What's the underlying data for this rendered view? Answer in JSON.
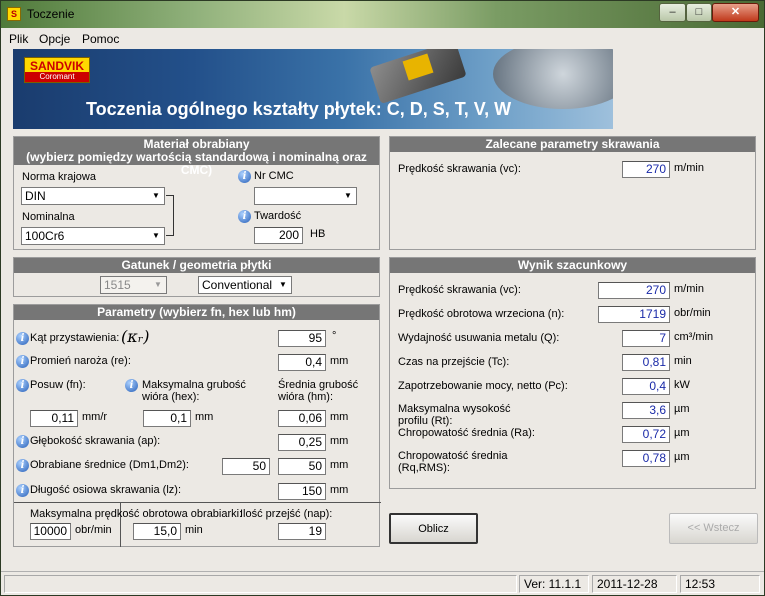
{
  "window": {
    "title": "Toczenie",
    "app_icon": "S",
    "controls": {
      "minimize": "–",
      "maximize": "□",
      "close": "✕"
    }
  },
  "menu": [
    "Plik",
    "Opcje",
    "Pomoc"
  ],
  "banner": {
    "logo_name": "SANDVIK",
    "logo_sub": "Coromant",
    "title": "Toczenia ogólnego  kształty płytek:  C, D, S, T, V, W"
  },
  "material": {
    "header_line1": "Materiał obrabiany",
    "header_line2": "(wybierz pomiędzy wartością standardową i nominalną oraz CMC)",
    "norma_label": "Norma krajowa",
    "norma_value": "DIN",
    "nominalna_label": "Nominalna",
    "nominalna_value": "100Cr6",
    "cmc_label": "Nr CMC",
    "cmc_value": "",
    "twardosc_label": "Twardość",
    "twardosc_value": "200",
    "twardosc_unit": "HB"
  },
  "gatunek": {
    "header": "Gatunek / geometria płytki",
    "grade_value": "1515",
    "geometry_value": "Conventional"
  },
  "params": {
    "header": "Parametry (wybierz fn, hex lub hm)",
    "kat_label": "Kąt przystawienia:",
    "kappa_symbol": "(κᵣ)",
    "kat_value": "95",
    "kat_unit": "°",
    "promien_label": "Promień naroża (re):",
    "promien_value": "0,4",
    "promien_unit": "mm",
    "posuw_label": "Posuw (fn):",
    "posuw_value": "0,11",
    "posuw_unit": "mm/r",
    "hex_label1": "Maksymalna grubość",
    "hex_label2": "wióra (hex):",
    "hex_value": "0,1",
    "hex_unit": "mm",
    "hm_label1": "Średnia grubość",
    "hm_label2": "wióra (hm):",
    "hm_value": "0,06",
    "hm_unit": "mm",
    "ap_label": "Głębokość skrawania (ap):",
    "ap_value": "0,25",
    "ap_unit": "mm",
    "dm_label": "Obrabiane średnice (Dm1,Dm2):",
    "dm1_value": "50",
    "dm2_value": "50",
    "dm_unit": "mm",
    "lz_label": "Długość osiowa skrawania (lz):",
    "lz_value": "150",
    "lz_unit": "mm",
    "maxrpm_label": "Maksymalna prędkość obrotowa obrabiarki:",
    "maxrpm_value": "10000",
    "maxrpm_unit": "obr/min",
    "nap_label": "Ilość przejść (nap):",
    "time_value": "15,0",
    "time_unit": "min",
    "nap_value": "19"
  },
  "zalecane": {
    "header": "Zalecane parametry skrawania",
    "vc_label": "Prędkość skrawania (vc):",
    "vc_value": "270",
    "vc_unit": "m/min"
  },
  "wynik": {
    "header": "Wynik szacunkowy",
    "vc_label": "Prędkość skrawania (vc):",
    "vc_value": "270",
    "vc_unit": "m/min",
    "n_label": "Prędkość obrotowa wrzeciona (n):",
    "n_value": "1719",
    "n_unit": "obr/min",
    "q_label": "Wydajność usuwania metalu (Q):",
    "q_value": "7",
    "q_unit": "cm³/min",
    "tc_label": "Czas na przejście (Tc):",
    "tc_value": "0,81",
    "tc_unit": "min",
    "pc_label": "Zapotrzebowanie mocy, netto (Pc):",
    "pc_value": "0,4",
    "pc_unit": "kW",
    "rt_label1": "Maksymalna wysokość",
    "rt_label2": "profilu (Rt):",
    "rt_value": "3,6",
    "rt_unit": "µm",
    "ra_label": "Chropowatość średnia (Ra):",
    "ra_value": "0,72",
    "ra_unit": "µm",
    "rq_label1": "Chropowatość średnia",
    "rq_label2": "(Rq,RMS):",
    "rq_value": "0,78",
    "rq_unit": "µm"
  },
  "buttons": {
    "oblicz": "Oblicz",
    "wstecz": "<< Wstecz"
  },
  "status": {
    "version": "Ver: 11.1.1",
    "date": "2011-12-28",
    "time": "12:53"
  }
}
